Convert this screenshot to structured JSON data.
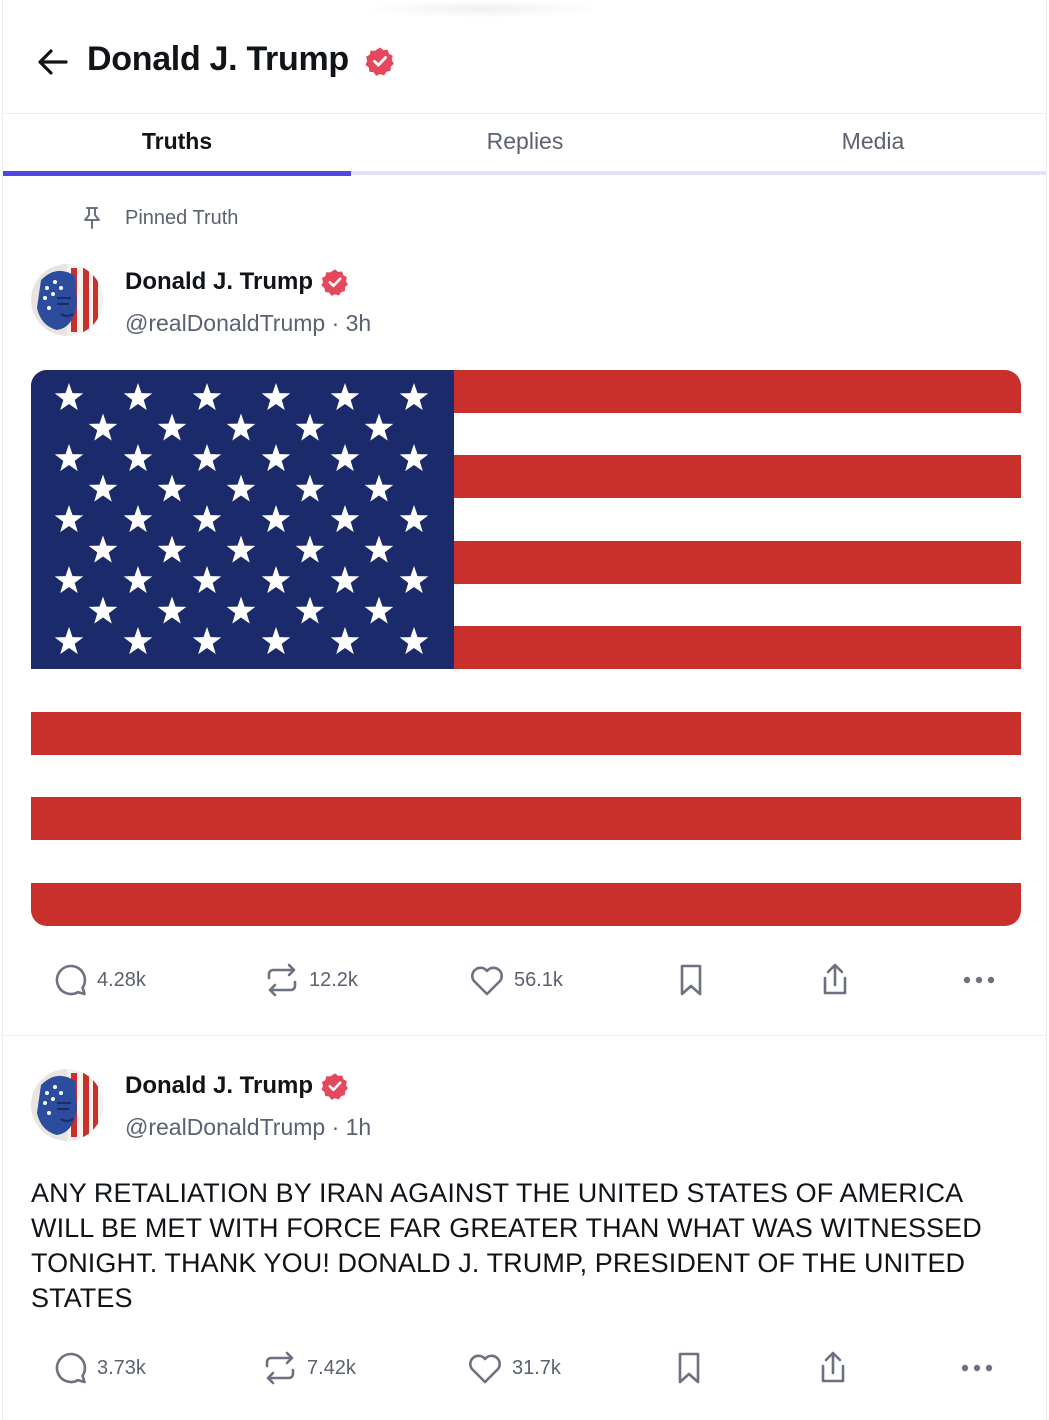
{
  "header": {
    "title": "Donald J. Trump",
    "back_icon": "arrow-left-icon",
    "verified_icon": "verified-badge-icon"
  },
  "tabs": [
    {
      "label": "Truths",
      "active": true
    },
    {
      "label": "Replies",
      "active": false
    },
    {
      "label": "Media",
      "active": false
    }
  ],
  "pinned": {
    "label": "Pinned Truth",
    "icon": "pin-icon"
  },
  "posts": [
    {
      "author": "Donald J. Trump",
      "handle_time": "@realDonaldTrump · 3h",
      "media": "us-flag-image",
      "actions": {
        "replies": "4.28k",
        "retruths": "12.2k",
        "likes": "56.1k"
      }
    },
    {
      "author": "Donald J. Trump",
      "handle_time": "@realDonaldTrump · 1h",
      "text": "ANY RETALIATION BY IRAN AGAINST THE UNITED STATES OF AMERICA WILL BE MET WITH FORCE FAR GREATER THAN WHAT WAS WITNESSED TONIGHT. THANK YOU! DONALD J. TRUMP, PRESIDENT OF THE UNITED STATES",
      "actions": {
        "replies": "3.73k",
        "retruths": "7.42k",
        "likes": "31.7k"
      }
    }
  ],
  "colors": {
    "accent": "#4f46e5",
    "verified": "#e5485d",
    "flag_red": "#c9302c",
    "flag_blue": "#1b2a6b"
  }
}
